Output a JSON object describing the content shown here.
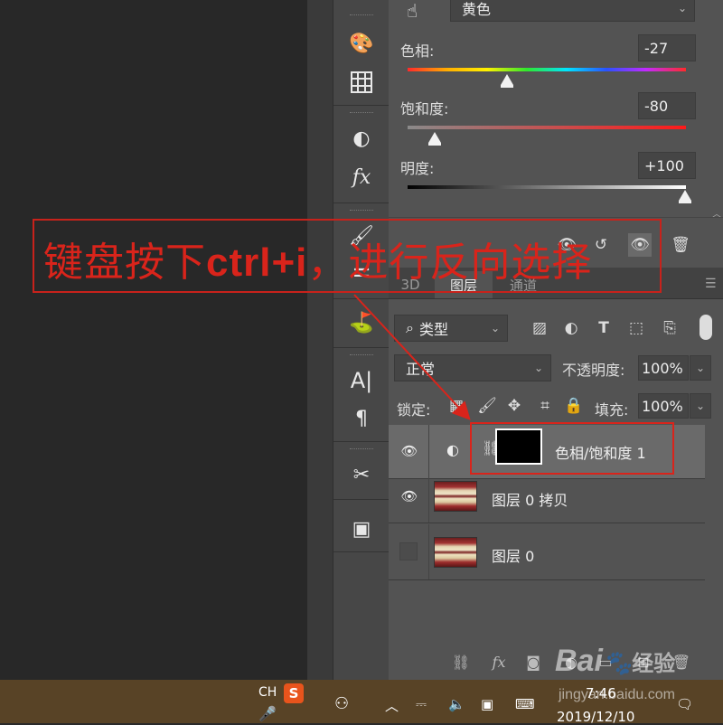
{
  "toolbar": {
    "icons": [
      "palette-icon",
      "grid-icon",
      "adjustment-icon",
      "fx-icon",
      "brush-presets-icon",
      "brush-settings-icon",
      "clone-source-icon",
      "character-icon",
      "paragraph-icon",
      "tool-presets-icon",
      "layer-comps-icon"
    ]
  },
  "properties": {
    "channel_dropdown": "黄色",
    "hue_label": "色相:",
    "hue_value": "-27",
    "hue_fraction": 0.36,
    "saturation_label": "饱和度:",
    "saturation_value": "-80",
    "saturation_fraction": 0.1,
    "lightness_label": "明度:",
    "lightness_value": "+100",
    "lightness_fraction": 1.0
  },
  "layers_panel": {
    "tabs": [
      "3D",
      "图层",
      "通道"
    ],
    "active_tab": "图层",
    "filter_dropdown": "类型",
    "blend_mode": "正常",
    "opacity_label": "不透明度:",
    "opacity_value": "100%",
    "lock_label": "锁定:",
    "fill_label": "填充:",
    "fill_value": "100%",
    "layers": [
      {
        "name": "色相/饱和度 1",
        "visible": true,
        "selected": true
      },
      {
        "name": "图层 0 拷贝",
        "visible": true,
        "selected": false
      },
      {
        "name": "图层 0",
        "visible": false,
        "selected": false
      }
    ]
  },
  "annotation": {
    "prefix": "键盘按下",
    "shortcut": "ctrl+i",
    "suffix": "，进行反向选择",
    "color": "#d9241b"
  },
  "taskbar": {
    "ime_label": "CH",
    "time": "7:46",
    "date": "2019/12/10"
  },
  "watermark": {
    "brand": "Bai",
    "brand2": "经验",
    "url": "jingyan.baidu.com"
  }
}
